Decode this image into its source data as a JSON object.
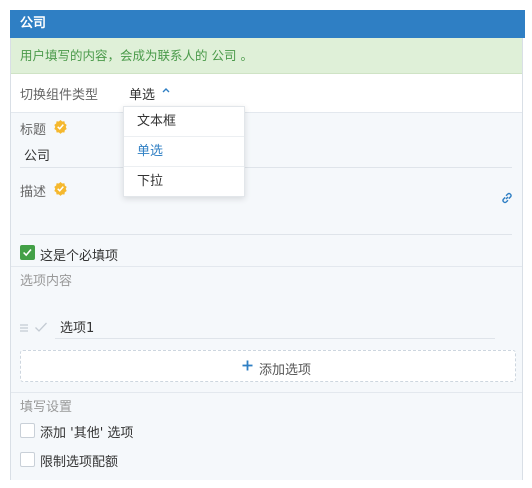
{
  "header": {
    "title": "公司"
  },
  "hint": {
    "text": "用户填写的内容，会成为联系人的 公司 。"
  },
  "type_switch": {
    "label": "切换组件类型",
    "value": "单选",
    "options": [
      "文本框",
      "单选",
      "下拉"
    ],
    "selected_index": 1
  },
  "title_field": {
    "label": "标题",
    "value": "公司"
  },
  "desc_field": {
    "label": "描述",
    "value": ""
  },
  "required": {
    "label": "这是个必填项",
    "checked": true
  },
  "options_section": {
    "label": "选项内容",
    "items": [
      "选项1"
    ],
    "add_label": "添加选项"
  },
  "fill_settings": {
    "label": "填写设置",
    "add_other_label": "添加 '其他' 选项",
    "limit_label": "限制选项配额"
  },
  "colors": {
    "header_bg": "#2f7fc4",
    "hint_bg": "#dff0d8",
    "hint_text": "#4a9a4a",
    "accent": "#2f7fc4",
    "check_green": "#43a047",
    "verified_gold": "#f5b82e"
  }
}
